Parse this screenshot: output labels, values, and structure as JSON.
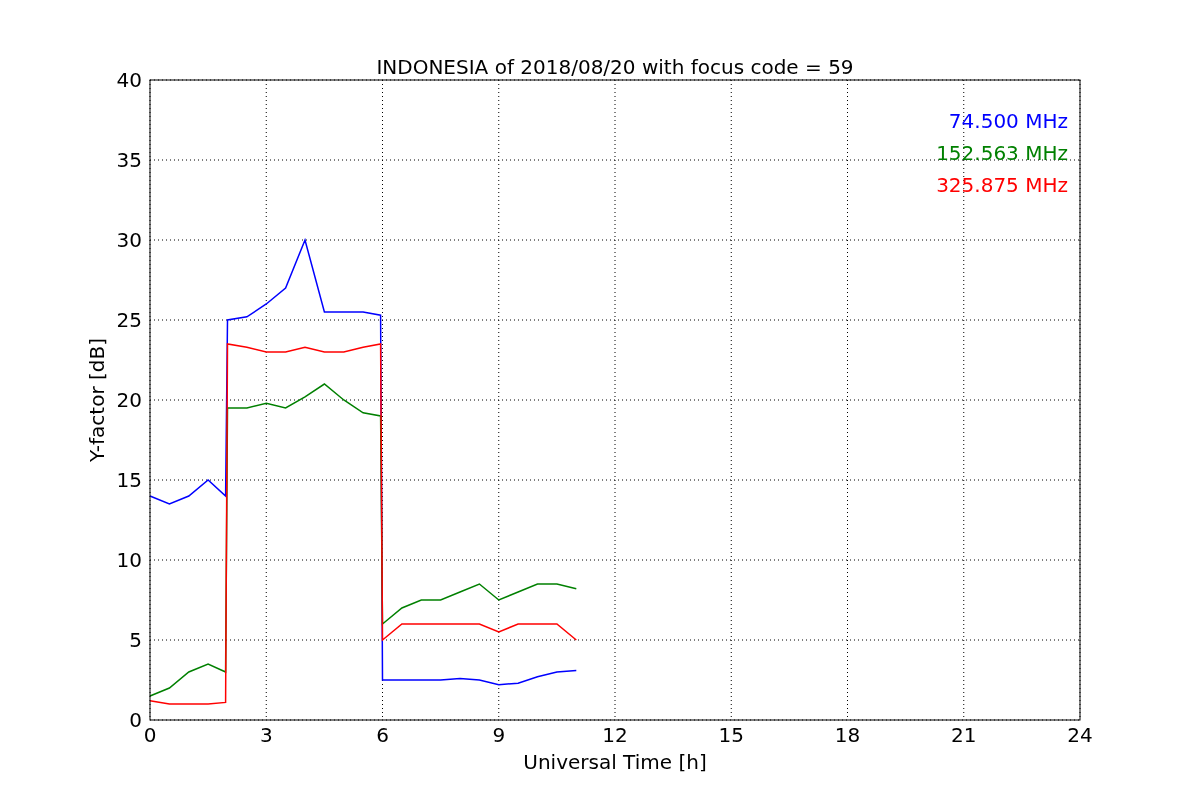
{
  "chart_data": {
    "type": "line",
    "title": "INDONESIA of 2018/08/20 with focus code = 59",
    "xlabel": "Universal Time [h]",
    "ylabel": "Y-factor [dB]",
    "x": [
      0,
      0.5,
      1,
      1.5,
      1.95,
      2,
      2.5,
      3,
      3.5,
      4,
      4.5,
      5,
      5.5,
      5.95,
      6,
      6.5,
      7,
      7.5,
      8,
      8.5,
      9,
      9.5,
      10,
      10.5,
      11
    ],
    "series": [
      {
        "name": "74.500 MHz",
        "color": "#0000ff",
        "values": [
          14,
          13.5,
          14,
          15,
          14,
          25,
          25.2,
          26,
          27,
          30,
          25.5,
          25.5,
          25.5,
          25.3,
          2.5,
          2.5,
          2.5,
          2.5,
          2.6,
          2.5,
          2.2,
          2.3,
          2.7,
          3,
          3.1
        ]
      },
      {
        "name": "152.563 MHz",
        "color": "#008000",
        "values": [
          1.5,
          2,
          3,
          3.5,
          3,
          19.5,
          19.5,
          19.8,
          19.5,
          20.2,
          21,
          20,
          19.2,
          19,
          6,
          7,
          7.5,
          7.5,
          8,
          8.5,
          7.5,
          8,
          8.5,
          8.5,
          8.2
        ]
      },
      {
        "name": "325.875 MHz",
        "color": "#ff0000",
        "values": [
          1.2,
          1,
          1,
          1,
          1.1,
          23.5,
          23.3,
          23,
          23,
          23.3,
          23,
          23,
          23.3,
          23.5,
          5,
          6,
          6,
          6,
          6,
          6,
          5.5,
          6,
          6,
          6,
          5
        ]
      }
    ],
    "grid": true,
    "xlim": [
      0,
      24
    ],
    "ylim": [
      0,
      40
    ],
    "xticks": [
      0,
      3,
      6,
      9,
      12,
      15,
      18,
      21,
      24
    ],
    "yticks": [
      0,
      5,
      10,
      15,
      20,
      25,
      30,
      35,
      40
    ]
  }
}
